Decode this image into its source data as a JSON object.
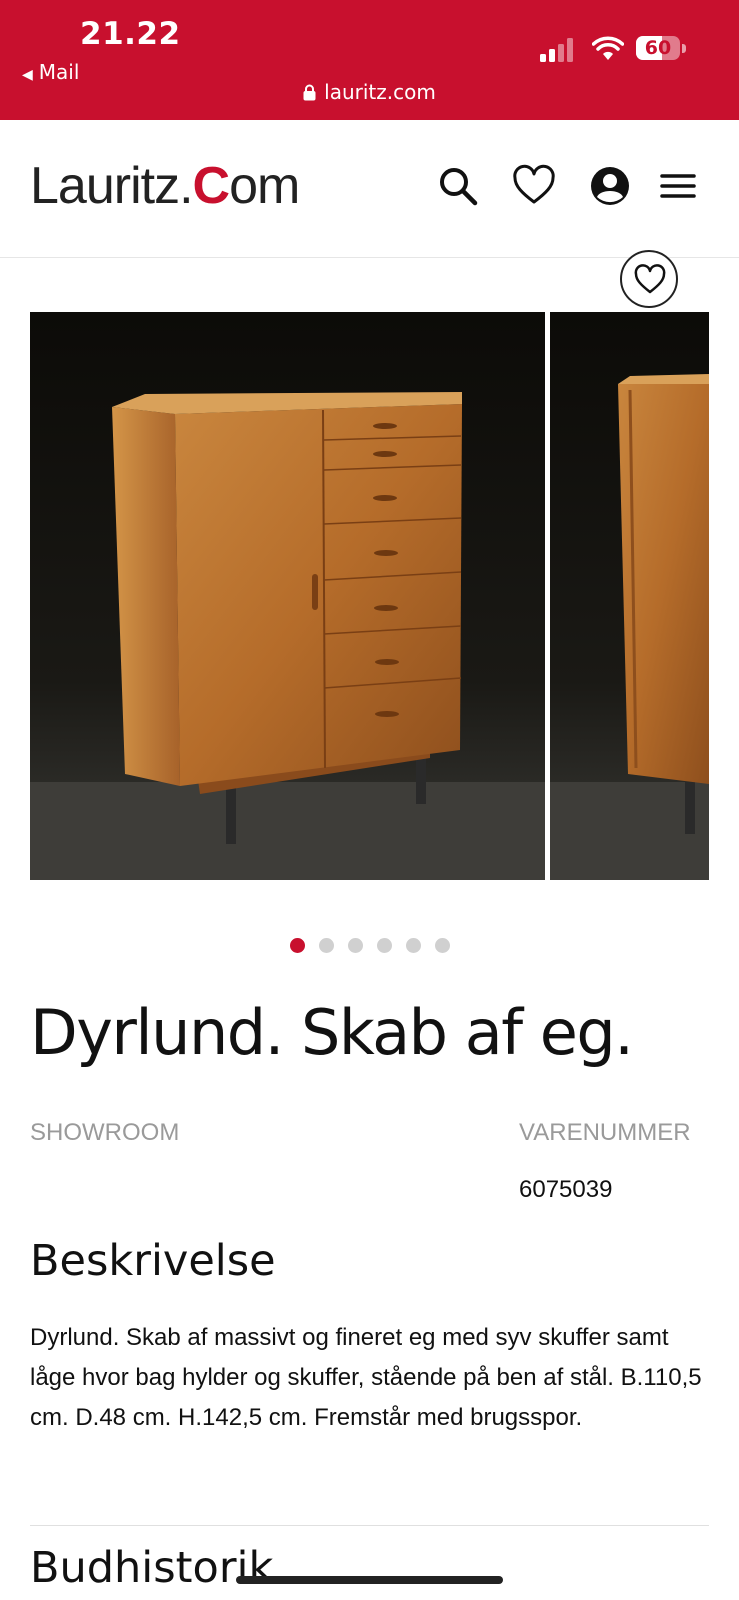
{
  "status_bar": {
    "time": "21.22",
    "back_app": "Mail",
    "url": "lauritz.com",
    "battery": "60",
    "battery_level": 0.6
  },
  "brand": {
    "logo_text_left": "Lauritz.",
    "logo_text_c": "C",
    "logo_text_right": "om",
    "accent_color": "#c8102e"
  },
  "header_icons": [
    "search-icon",
    "heart-icon",
    "user-icon",
    "menu-icon"
  ],
  "gallery": {
    "image_count": 6,
    "active_index": 0
  },
  "product": {
    "title": "Dyrlund. Skab af eg.",
    "showroom_label": "SHOWROOM",
    "item_number_label": "VARENUMMER",
    "item_number": "6075039",
    "description_heading": "Beskrivelse",
    "description": "Dyrlund. Skab af massivt og fineret eg med syv skuffer samt låge hvor bag hylder og skuffer, stående på ben af stål. B.110,5 cm. D.48 cm. H.142,5 cm. Fremstår med brugsspor.",
    "bid_history_heading": "Budhistorik"
  }
}
